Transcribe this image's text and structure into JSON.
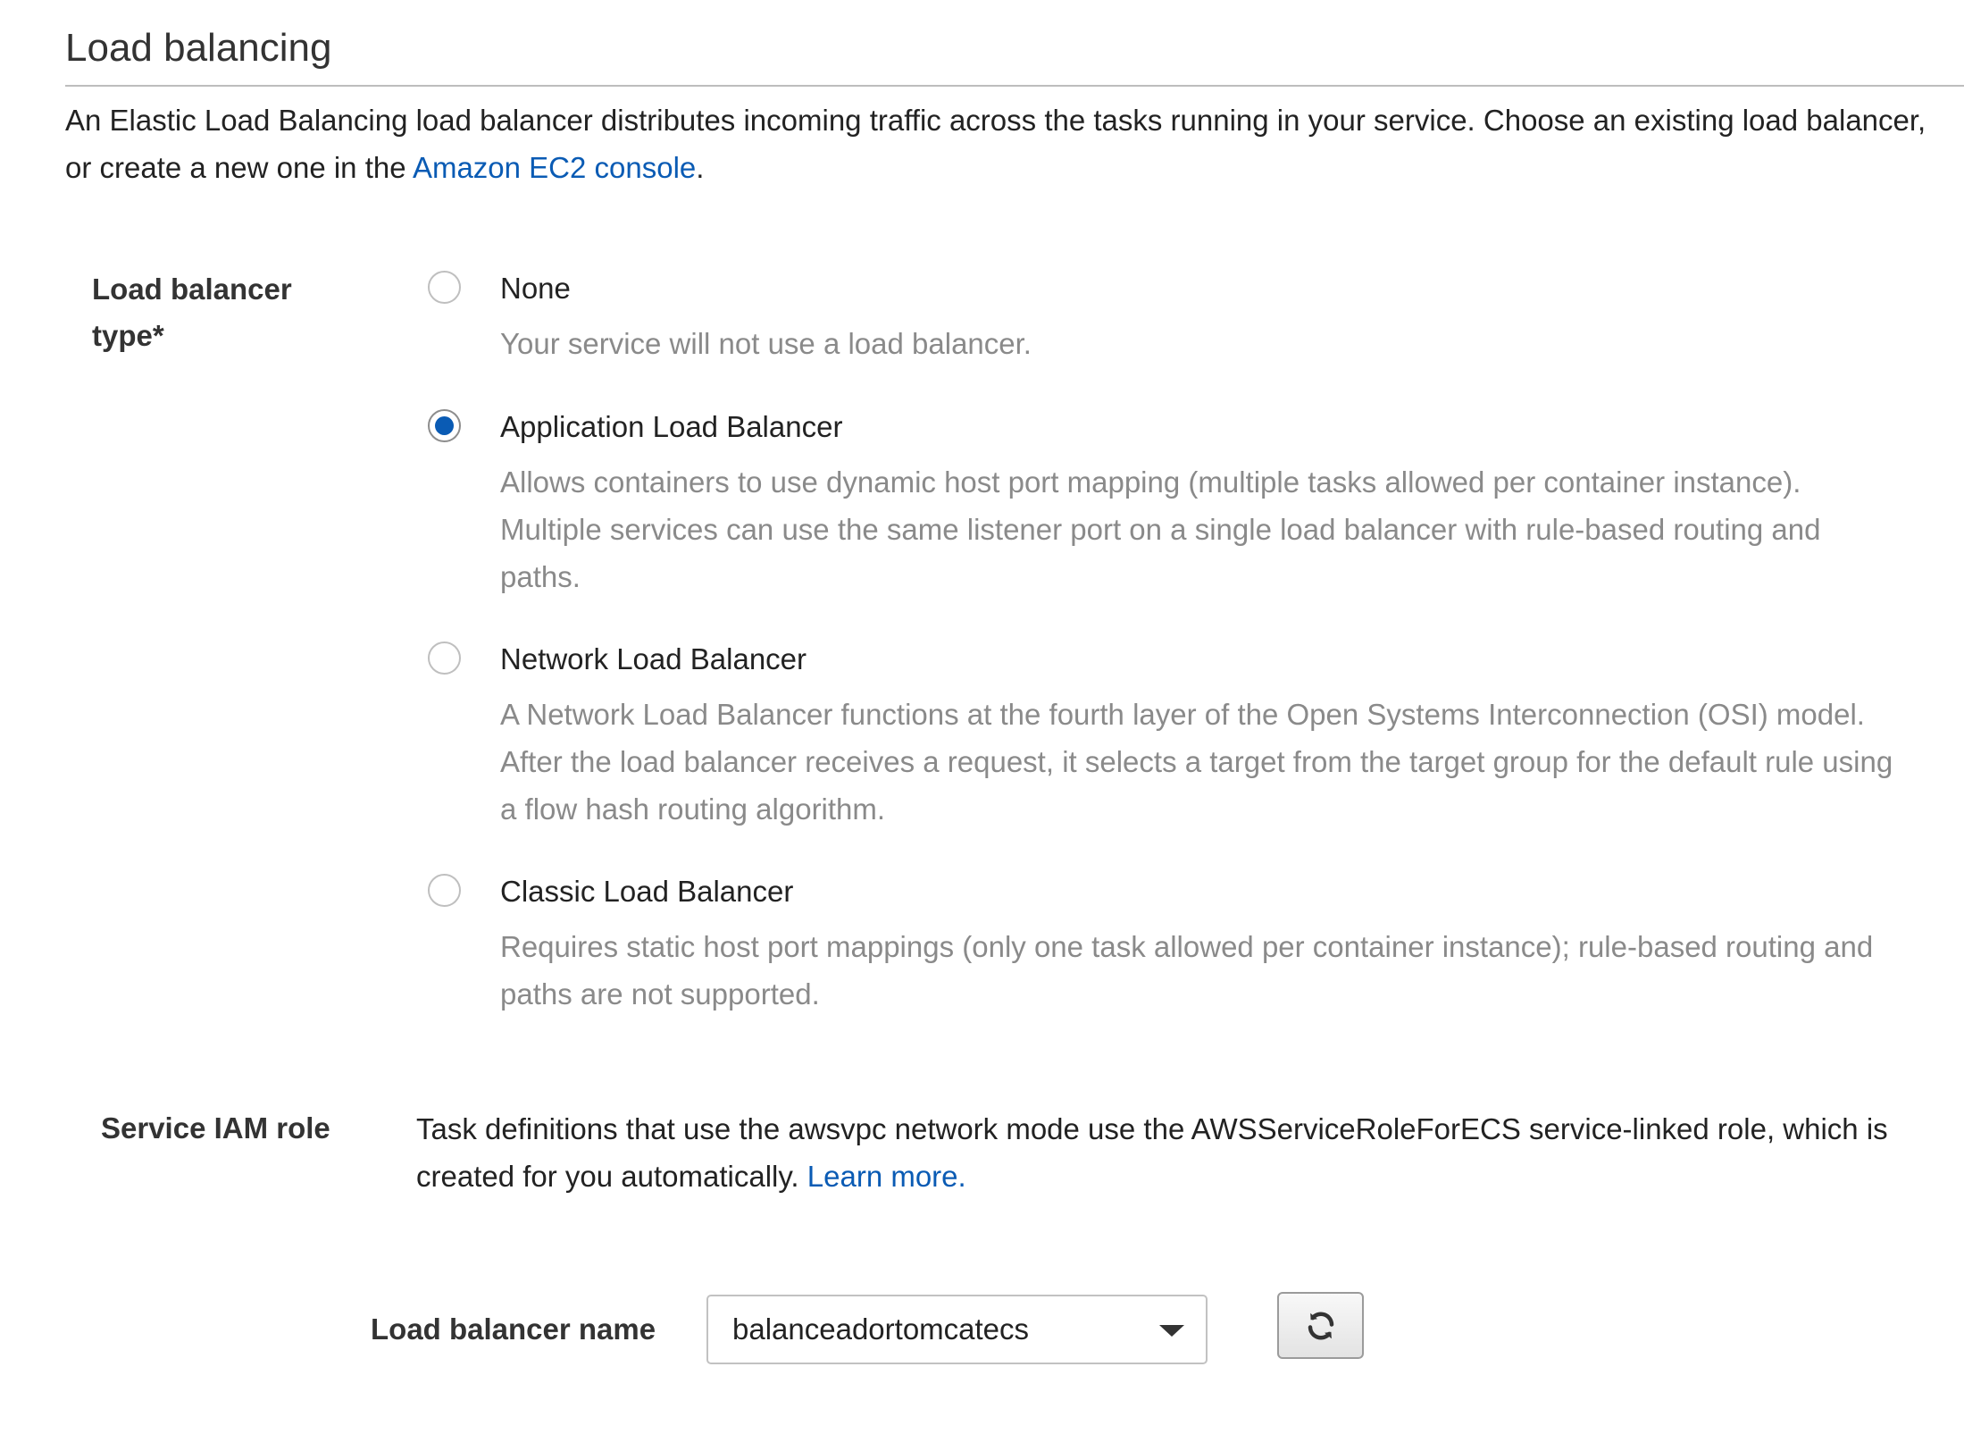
{
  "section": {
    "title": "Load balancing",
    "description_prefix": "An Elastic Load Balancing load balancer distributes incoming traffic across the tasks running in your service. Choose an existing load balancer, or create a new one in the ",
    "description_link": "Amazon EC2 console",
    "description_suffix": "."
  },
  "load_balancer_type": {
    "label_line1": "Load balancer",
    "label_line2": "type*",
    "selected": "Application Load Balancer",
    "options": [
      {
        "title": "None",
        "description": "Your service will not use a load balancer."
      },
      {
        "title": "Application Load Balancer",
        "description": "Allows containers to use dynamic host port mapping (multiple tasks allowed per container instance). Multiple services can use the same listener port on a single load balancer with rule-based routing and paths."
      },
      {
        "title": "Network Load Balancer",
        "description": "A Network Load Balancer functions at the fourth layer of the Open Systems Interconnection (OSI) model. After the load balancer receives a request, it selects a target from the target group for the default rule using a flow hash routing algorithm."
      },
      {
        "title": "Classic Load Balancer",
        "description": "Requires static host port mappings (only one task allowed per container instance); rule-based routing and paths are not supported."
      }
    ]
  },
  "service_iam_role": {
    "label": "Service IAM role",
    "text": "Task definitions that use the awsvpc network mode use the AWSServiceRoleForECS service-linked role, which is created for you automatically. ",
    "link": "Learn more."
  },
  "load_balancer_name": {
    "label": "Load balancer name",
    "value": "balanceadortomcatecs"
  },
  "icons": {
    "dropdown": "caret-down-icon",
    "refresh": "refresh-icon"
  },
  "colors": {
    "link": "#0a5bb4",
    "selected_radio": "#0a5bb4",
    "description_text": "#8a8a8a"
  }
}
